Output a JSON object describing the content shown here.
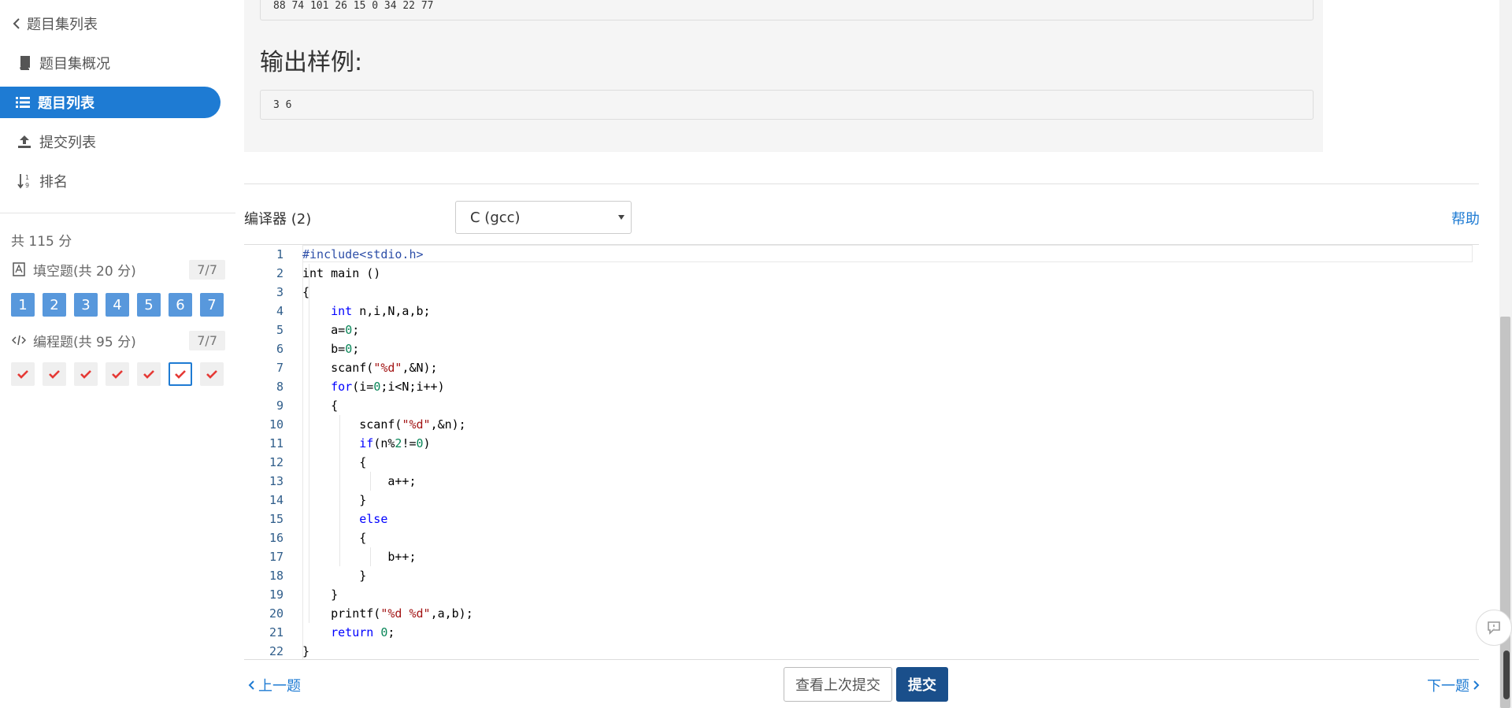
{
  "sidebar": {
    "back_label": "题目集列表",
    "items": [
      {
        "label": "题目集概况",
        "icon": "book-icon"
      },
      {
        "label": "题目列表",
        "icon": "list-icon",
        "active": true
      },
      {
        "label": "提交列表",
        "icon": "upload-icon"
      },
      {
        "label": "排名",
        "icon": "sort-numeric-icon"
      }
    ],
    "total_score": "共 115 分",
    "fill_section": {
      "label": "填空题(共 20 分)",
      "count": "7/7",
      "numbers": [
        "1",
        "2",
        "3",
        "4",
        "5",
        "6",
        "7"
      ]
    },
    "prog_section": {
      "label": "编程题(共 95 分)",
      "count": "7/7",
      "items": 7,
      "active_index": 5
    }
  },
  "samples": {
    "input_value": "88 74 101 26 15 0 34 22 77",
    "output_heading": "输出样例:",
    "output_value": "3 6"
  },
  "editor": {
    "label": "编译器 (2)",
    "language": "C (gcc)",
    "help": "帮助",
    "lines": [
      "1",
      "2",
      "3",
      "4",
      "5",
      "6",
      "7",
      "8",
      "9",
      "10",
      "11",
      "12",
      "13",
      "14",
      "15",
      "16",
      "17",
      "18",
      "19",
      "20",
      "21",
      "22"
    ]
  },
  "footer": {
    "prev": "上一题",
    "last_submission": "查看上次提交",
    "submit": "提交",
    "next": "下一题"
  },
  "colors": {
    "accent": "#1e7bd3",
    "submit": "#1a4f8b",
    "number_box": "#5898dc",
    "check": "#e53935"
  }
}
